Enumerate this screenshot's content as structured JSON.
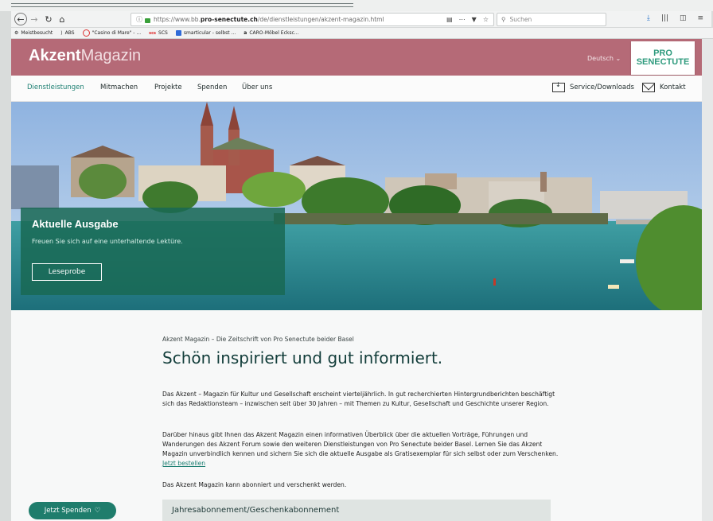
{
  "browser": {
    "url_prefix": "https://www.bb.",
    "url_domain": "pro-senectute.ch",
    "url_path": "/de/dienstleistungen/akzent-magazin.html",
    "search_placeholder": "Suchen",
    "icons": [
      "back-icon",
      "forward-icon",
      "reload-icon",
      "home-icon",
      "info-icon",
      "lock-icon",
      "reader-icon",
      "more-icon",
      "pocket-icon",
      "star-icon",
      "search-icon",
      "download-icon",
      "library-icon",
      "sidebar-icon",
      "menu-icon"
    ]
  },
  "bookmarks": [
    {
      "label": "Meistbesucht"
    },
    {
      "label": "ABS"
    },
    {
      "label": "\"Casino di Mare\" - ..."
    },
    {
      "label": "SCS"
    },
    {
      "label": "smarticular - selbst ..."
    },
    {
      "label": "CARO-Möbel Ecksc..."
    }
  ],
  "header": {
    "logo_strong": "Akzent",
    "logo_light": "Magazin",
    "language": "Deutsch",
    "brand_line1": "PRO",
    "brand_line2": "SENECTUTE",
    "colors": {
      "header_bg": "#b56a77",
      "brand_green": "#2f9b7e"
    }
  },
  "nav": {
    "items": [
      {
        "label": "Dienstleistungen",
        "active": true
      },
      {
        "label": "Mitmachen"
      },
      {
        "label": "Projekte"
      },
      {
        "label": "Spenden"
      },
      {
        "label": "Über uns"
      }
    ],
    "service": "Service/Downloads",
    "contact": "Kontakt"
  },
  "hero": {
    "title": "Aktuelle Ausgabe",
    "subtitle": "Freuen Sie sich auf eine unterhaltende Lektüre.",
    "button": "Leseprobe"
  },
  "main": {
    "kicker": "Akzent Magazin – Die Zeitschrift von Pro Senectute beider Basel",
    "headline": "Schön inspiriert und gut informiert.",
    "p1": "Das Akzent – Magazin für Kultur und Gesellschaft erscheint vierteljährlich. In gut recherchierten Hintergrundberichten beschäftigt sich das Redaktionsteam – inzwischen seit über 30 Jahren – mit Themen zu Kultur, Gesellschaft und Geschichte unserer Region.",
    "p2": "Darüber hinaus gibt Ihnen das Akzent Magazin einen informativen Überblick über die aktuellen Vorträge, Führungen und Wanderungen des Akzent Forum sowie den weiteren Dienstleistungen von Pro Senectute beider Basel. Lernen Sie das Akzent Magazin unverbindlich kennen und sichern Sie sich die aktuelle Ausgabe als Gratisexemplar für sich selbst oder zum Verschenken.",
    "p2_link": "Jetzt bestellen",
    "p3": "Das Akzent Magazin kann abonniert und verschenkt werden.",
    "accordion": "Jahresabonnement/Geschenkabonnement"
  },
  "donate": {
    "label": "Jetzt Spenden"
  }
}
